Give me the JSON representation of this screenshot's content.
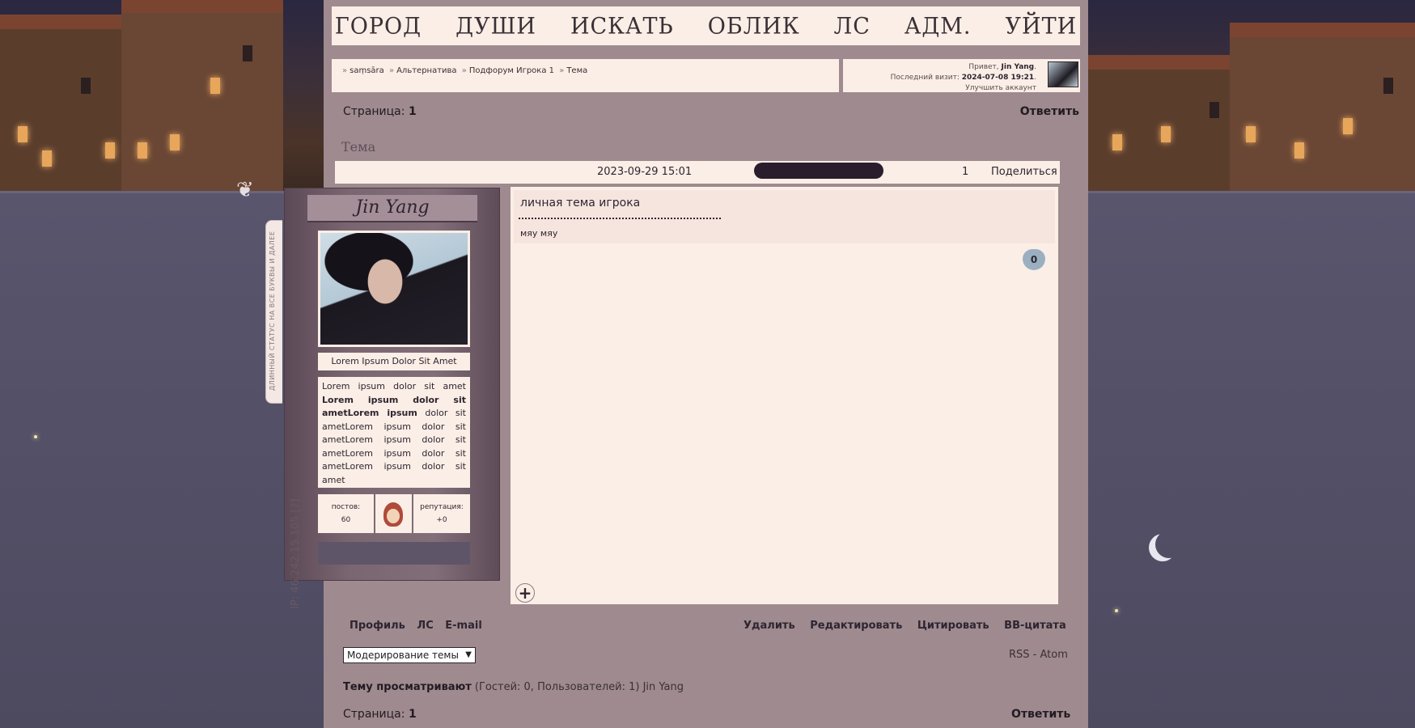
{
  "nav": {
    "items": [
      "ГОРОД",
      "ДУШИ",
      "ИСКАТЬ",
      "ОБЛИК",
      "ЛС",
      "АДМ.",
      "УЙТИ"
    ]
  },
  "breadcrumbs": [
    "saṃsāra",
    "Альтернатива",
    "Подфорум Игрока 1",
    "Тема"
  ],
  "breadcrumb_separator": "»",
  "user": {
    "greeting": "Привет,",
    "name": "Jin Yang",
    "last_visit_label": "Последний визит:",
    "last_visit": "2024-07-08 19:21",
    "upgrade": "Улучшить аккаунт"
  },
  "pagination": {
    "label": "Страница:",
    "current": "1"
  },
  "reply_label": "Ответить",
  "topic_title": "Тема",
  "post": {
    "date": "2023-09-29 15:01",
    "number": "1",
    "share": "Поделиться",
    "heading": "личная тема игрока",
    "text": "мяу мяу",
    "likes": "0",
    "add": "+"
  },
  "author": {
    "name": "Jin Yang",
    "status_tab": "ДЛИННЫЙ СТАТУС НА ВСЕ БУКВЫ И ДАЛЕЕ",
    "ip": "IP: 46.242.15.105 [?]",
    "field_title": "Lorem Ipsum Dolor Sit Amet",
    "bio_plain": "Lorem ipsum dolor sit amet",
    "bio_bold": "Lorem ipsum dolor sit ametLorem ipsum",
    "bio_rest": "dolor sit ametLorem ipsum dolor sit ametLorem ipsum dolor sit ametLorem ipsum dolor sit ametLorem ipsum dolor sit amet",
    "posts_label": "постов:",
    "posts_value": "60",
    "rep_label": "репутация:",
    "rep_value": "+0"
  },
  "post_links_left": [
    "Профиль",
    "ЛС",
    "E-mail"
  ],
  "post_links_right": [
    "Удалить",
    "Редактировать",
    "Цитировать",
    "BB-цитата"
  ],
  "moderation_select": "Модерирование темы",
  "feeds": "RSS - Atom",
  "viewers": {
    "label": "Тему просматривают",
    "detail": "(Гостей: 0, Пользователей: 1) Jin Yang"
  },
  "colors": {
    "content_bg": "#9e8a8f",
    "panel_bg": "#fbeee6",
    "page_bg": "#56526a",
    "dark_accent": "#2a1e2c"
  }
}
